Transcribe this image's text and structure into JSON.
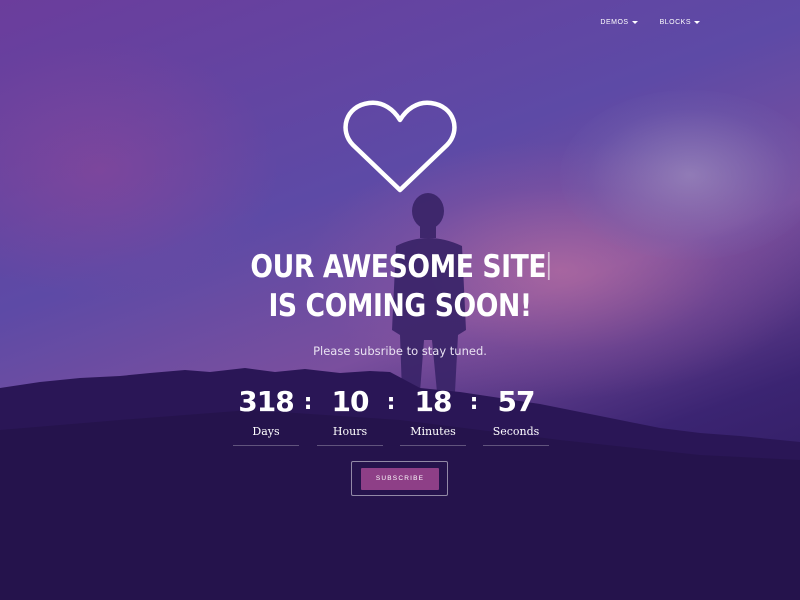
{
  "nav": {
    "items": [
      {
        "label": "DEMOS"
      },
      {
        "label": "BLOCKS"
      }
    ]
  },
  "hero": {
    "icon": "heart-outline-icon",
    "title_line1": "OUR  AWESOME SITE",
    "title_line2": "IS COMING SOON!",
    "subtitle": "Please subsribe to stay tuned."
  },
  "countdown": {
    "days": {
      "value": "318",
      "label": "Days"
    },
    "hours": {
      "value": "10",
      "label": "Hours"
    },
    "minutes": {
      "value": "18",
      "label": "Minutes"
    },
    "seconds": {
      "value": "57",
      "label": "Seconds"
    },
    "separator": ":"
  },
  "subscribe": {
    "label": "SUBSCRIBE"
  },
  "colors": {
    "accent": "#8e3f87",
    "text": "#ffffff"
  }
}
